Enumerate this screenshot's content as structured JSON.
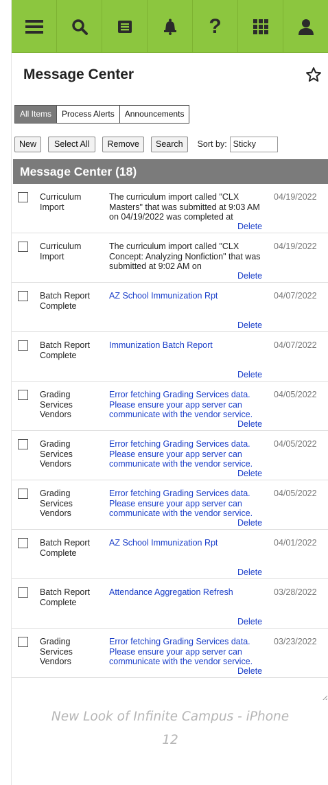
{
  "nav": {
    "icons": [
      "menu-icon",
      "search-icon",
      "message-icon",
      "bell-icon",
      "help-icon",
      "apps-icon",
      "user-icon"
    ],
    "help_glyph": "?"
  },
  "header": {
    "title": "Message Center"
  },
  "tabs": [
    {
      "label": "All Items",
      "active": true
    },
    {
      "label": "Process Alerts",
      "active": false
    },
    {
      "label": "Announcements",
      "active": false
    }
  ],
  "toolbar": {
    "new_label": "New",
    "select_all_label": "Select All",
    "remove_label": "Remove",
    "search_label": "Search",
    "sort_label": "Sort by:",
    "sort_value": "Sticky"
  },
  "section": {
    "title": "Message Center (18)"
  },
  "messages": [
    {
      "type": "Curriculum Import",
      "text": "The curriculum import called \"CLX Masters\" that was submitted at 9:03 AM on 04/19/2022 was completed at",
      "link": false,
      "date": "04/19/2022",
      "delete": "Delete"
    },
    {
      "type": "Curriculum Import",
      "text": "The curriculum import called \"CLX Concept: Analyzing Nonfiction\" that was submitted at 9:02 AM on",
      "link": false,
      "date": "04/19/2022",
      "delete": "Delete"
    },
    {
      "type": "Batch Report Complete",
      "text": "AZ School Immunization Rpt",
      "link": true,
      "date": "04/07/2022",
      "delete": "Delete"
    },
    {
      "type": "Batch Report Complete",
      "text": "Immunization Batch Report",
      "link": true,
      "date": "04/07/2022",
      "delete": "Delete"
    },
    {
      "type": "Grading Services Vendors",
      "text": "Error fetching Grading Services data. Please ensure your app server can communicate with the vendor service.",
      "link": true,
      "date": "04/05/2022",
      "delete": "Delete"
    },
    {
      "type": "Grading Services Vendors",
      "text": "Error fetching Grading Services data. Please ensure your app server can communicate with the vendor service.",
      "link": true,
      "date": "04/05/2022",
      "delete": "Delete"
    },
    {
      "type": "Grading Services Vendors",
      "text": "Error fetching Grading Services data. Please ensure your app server can communicate with the vendor service.",
      "link": true,
      "date": "04/05/2022",
      "delete": "Delete"
    },
    {
      "type": "Batch Report Complete",
      "text": "AZ School Immunization Rpt",
      "link": true,
      "date": "04/01/2022",
      "delete": "Delete"
    },
    {
      "type": "Batch Report Complete",
      "text": "Attendance Aggregation Refresh",
      "link": true,
      "date": "03/28/2022",
      "delete": "Delete"
    },
    {
      "type": "Grading Services Vendors",
      "text": "Error fetching Grading Services data. Please ensure your app server can communicate with the vendor service.",
      "link": true,
      "date": "03/23/2022",
      "delete": "Delete"
    }
  ],
  "caption": {
    "line1": "New Look of Infinite Campus - iPhone",
    "line2": "12"
  }
}
